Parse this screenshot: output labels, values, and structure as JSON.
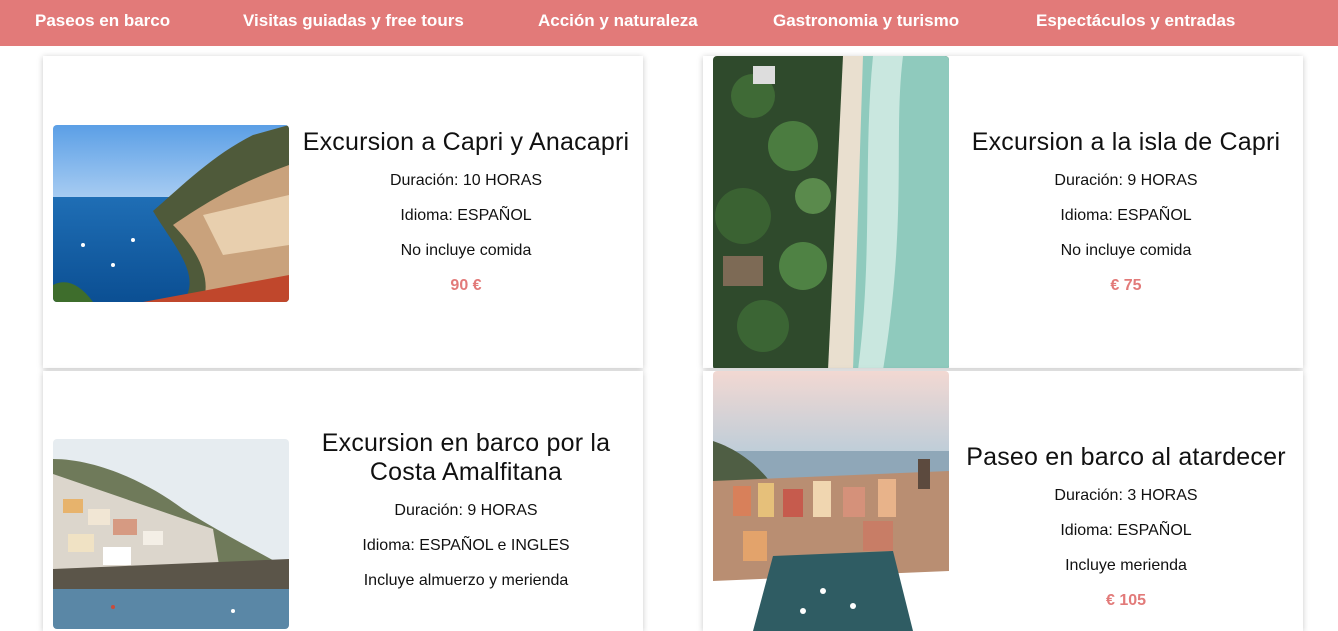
{
  "nav": {
    "items": [
      "Paseos en barco",
      "Visitas guiadas y free tours",
      "Acción y naturaleza",
      "Gastronomia y turismo",
      "Espectáculos y entradas"
    ]
  },
  "tours": [
    {
      "title": "Excursion a Capri y Anacapri",
      "duration": "Duración: 10 HORAS",
      "language": "Idioma: ESPAÑOL",
      "food": "No incluye comida",
      "price": "90 €"
    },
    {
      "title": "Excursion a la isla de Capri",
      "duration": "Duración: 9 HORAS",
      "language": "Idioma: ESPAÑOL",
      "food": "No incluye comida",
      "price": "€ 75"
    },
    {
      "title": "Excursion en barco por la Costa Amalfitana",
      "duration": "Duración: 9 HORAS",
      "language": "Idioma: ESPAÑOL e INGLES",
      "food": "Incluye almuerzo y merienda",
      "price": ""
    },
    {
      "title": "Paseo en barco al atardecer",
      "duration": "Duración: 3 HORAS",
      "language": "Idioma: ESPAÑOL",
      "food": "Incluye merienda",
      "price": "€ 105"
    }
  ],
  "colors": {
    "accent": "#e27a79",
    "text": "#111111"
  }
}
